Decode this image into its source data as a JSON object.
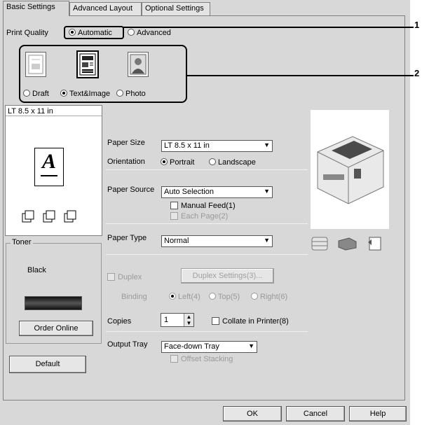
{
  "tabs": [
    {
      "label": "Basic Settings"
    },
    {
      "label": "Advanced Layout"
    },
    {
      "label": "Optional Settings"
    }
  ],
  "print_quality": {
    "label": "Print Quality",
    "automatic": "Automatic",
    "advanced": "Advanced",
    "selected": "Automatic"
  },
  "quality_modes": {
    "draft": "Draft",
    "text_image": "Text&Image",
    "photo": "Photo",
    "selected": "Text&Image"
  },
  "preview": {
    "paper_label": "LT 8.5 x 11 in",
    "letter": "A"
  },
  "paper_size": {
    "label": "Paper Size",
    "value": "LT 8.5 x 11 in"
  },
  "orientation": {
    "label": "Orientation",
    "portrait": "Portrait",
    "landscape": "Landscape",
    "selected": "Portrait"
  },
  "paper_source": {
    "label": "Paper Source",
    "value": "Auto Selection"
  },
  "manual_feed": "Manual Feed(1)",
  "each_page": "Each Page(2)",
  "toner": {
    "group": "Toner",
    "color": "Black",
    "order_button": "Order Online"
  },
  "paper_type": {
    "label": "Paper Type",
    "value": "Normal"
  },
  "duplex": {
    "label": "Duplex",
    "settings_button": "Duplex Settings(3)...",
    "binding_label": "Binding",
    "left": "Left(4)",
    "top": "Top(5)",
    "right": "Right(6)"
  },
  "copies": {
    "label": "Copies",
    "value": "1",
    "collate": "Collate in Printer(8)"
  },
  "output_tray": {
    "label": "Output Tray",
    "value": "Face-down Tray",
    "offset": "Offset Stacking"
  },
  "default_button": "Default",
  "footer": {
    "ok": "OK",
    "cancel": "Cancel",
    "help": "Help"
  },
  "callouts": {
    "one": "1",
    "two": "2"
  },
  "icons": [
    "draft-icon",
    "text-image-icon",
    "photo-icon",
    "printer-icon",
    "database-icon",
    "tray-icon",
    "page-settings-icon"
  ]
}
